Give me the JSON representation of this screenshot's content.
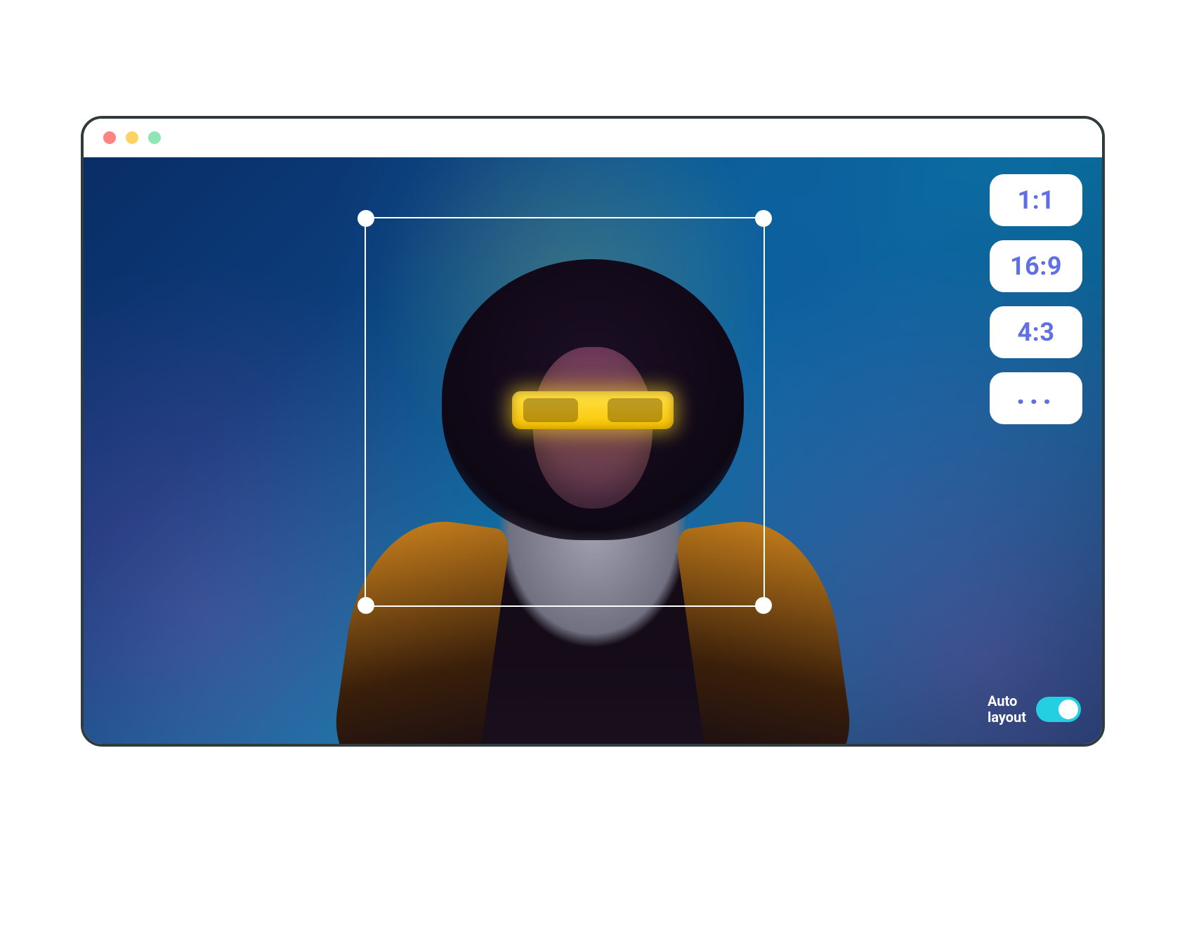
{
  "ratios": {
    "r0": "1:1",
    "r1": "16:9",
    "r2": "4:3",
    "more": "..."
  },
  "auto_layout": {
    "label": "Auto\nlayout",
    "enabled": true
  }
}
